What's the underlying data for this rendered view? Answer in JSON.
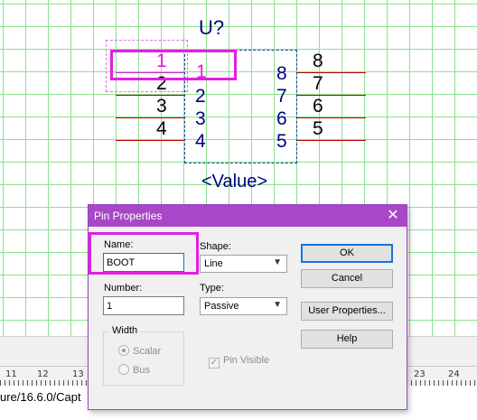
{
  "schematic": {
    "ref_designator": "U?",
    "value_text": "<Value>",
    "selected_pin": {
      "number": "1",
      "name": "1"
    },
    "left_pins": [
      {
        "number": "2",
        "name": "2"
      },
      {
        "number": "3",
        "name": "3"
      },
      {
        "number": "4",
        "name": "4"
      }
    ],
    "right_pins": [
      {
        "number": "8",
        "name": "8"
      },
      {
        "number": "7",
        "name": "7"
      },
      {
        "number": "6",
        "name": "6"
      },
      {
        "number": "5",
        "name": "5"
      }
    ]
  },
  "ruler": {
    "labels": [
      "11",
      "12",
      "13",
      "23",
      "24"
    ]
  },
  "status": {
    "path_text": "ure/16.6.0/Capt"
  },
  "dialog": {
    "title": "Pin Properties",
    "close_icon": "close-icon",
    "name": {
      "label": "Name:",
      "value": "BOOT"
    },
    "number": {
      "label": "Number:",
      "value": "1"
    },
    "shape": {
      "label": "Shape:",
      "value": "Line"
    },
    "type": {
      "label": "Type:",
      "value": "Passive"
    },
    "width": {
      "label": "Width",
      "options": [
        {
          "label": "Scalar",
          "selected": true
        },
        {
          "label": "Bus",
          "selected": false
        }
      ]
    },
    "pin_visible": {
      "label": "Pin Visible",
      "checked": true
    },
    "buttons": {
      "ok": "OK",
      "cancel": "Cancel",
      "user_properties": "User Properties...",
      "help": "Help"
    }
  },
  "colors": {
    "dialog_title": "#a947c9",
    "highlight": "#e020e0",
    "grid": "#8ee08e",
    "pin_line": "#c00000",
    "pin_name": "#000080"
  }
}
